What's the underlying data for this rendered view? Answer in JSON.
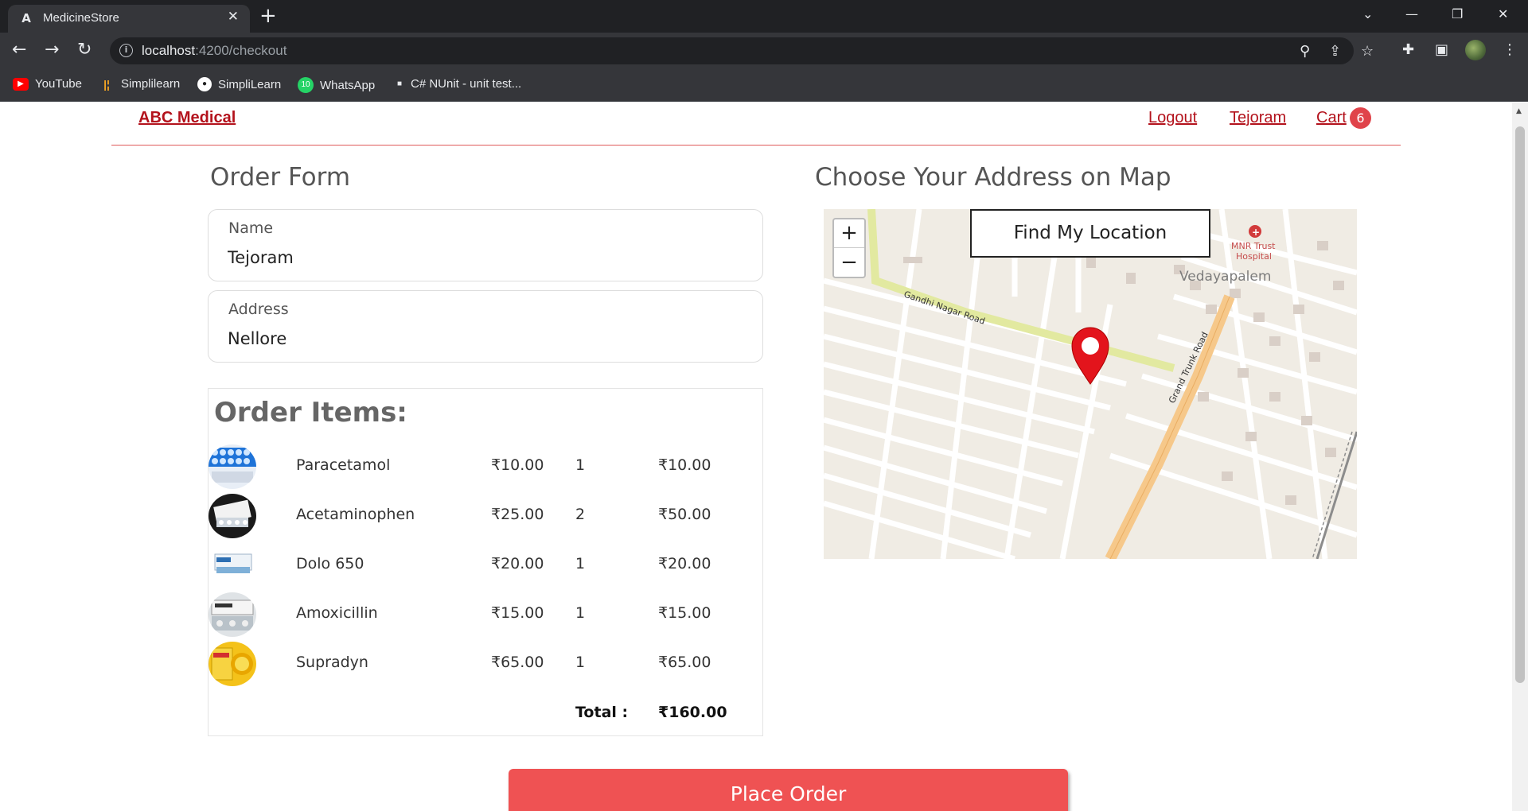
{
  "browser": {
    "tab_title": "MedicineStore",
    "url_host": "localhost",
    "url_path": ":4200/checkout",
    "bookmarks": [
      {
        "label": "YouTube",
        "icon": "youtube-icon",
        "color": "#ff0000"
      },
      {
        "label": "Simplilearn",
        "icon": "simplilearn-icon",
        "color": "#f5a623"
      },
      {
        "label": "SimpliLearn",
        "icon": "github-icon",
        "color": "#ffffff"
      },
      {
        "label": "WhatsApp",
        "icon": "whatsapp-icon",
        "color": "#25d366",
        "badge": "10"
      },
      {
        "label": "C# NUnit - unit test...",
        "icon": "page-icon",
        "color": "#ffffff"
      }
    ]
  },
  "navbar": {
    "brand": "ABC Medical",
    "links": [
      "Logout",
      "Tejoram",
      "Cart"
    ],
    "cart_count": "6"
  },
  "order_form": {
    "title": "Order Form",
    "name_label": "Name",
    "name_value": "Tejoram",
    "address_label": "Address",
    "address_value": "Nellore"
  },
  "order_items": {
    "title": "Order Items:",
    "items": [
      {
        "name": "Paracetamol",
        "price": "₹10.00",
        "qty": "1",
        "total": "₹10.00"
      },
      {
        "name": "Acetaminophen",
        "price": "₹25.00",
        "qty": "2",
        "total": "₹50.00"
      },
      {
        "name": "Dolo 650",
        "price": "₹20.00",
        "qty": "1",
        "total": "₹20.00"
      },
      {
        "name": "Amoxicillin",
        "price": "₹15.00",
        "qty": "1",
        "total": "₹15.00"
      },
      {
        "name": "Supradyn",
        "price": "₹65.00",
        "qty": "1",
        "total": "₹65.00"
      }
    ],
    "total_label": "Total :",
    "total_value": "₹160.00"
  },
  "map": {
    "title": "Choose Your Address on Map",
    "find_button": "Find My Location",
    "zoom_in": "+",
    "zoom_out": "−",
    "labels": {
      "road1": "Gandhi Nagar Road",
      "road2": "Grand Trunk Road",
      "area": "Vedayapalem",
      "hospital_line1": "MNR Trust",
      "hospital_line2": "Hospital"
    }
  },
  "place_order": "Place Order",
  "colors": {
    "accent_red": "#b3121c",
    "button_red": "#ef5253",
    "badge_red": "#e0434a"
  }
}
